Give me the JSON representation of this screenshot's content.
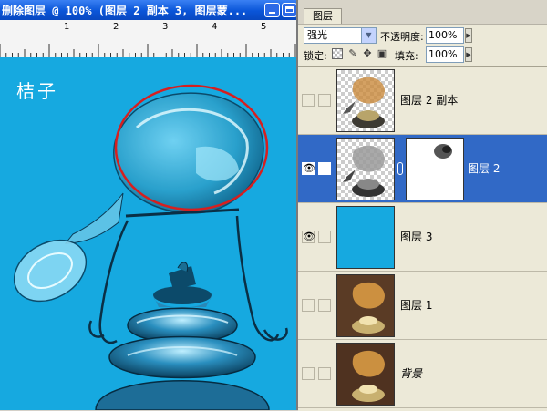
{
  "document": {
    "title": "删除图层 @ 100% (图层 2 副本 3, 图层蒙...",
    "canvas_text": "桔子",
    "ruler_numbers": [
      "1",
      "2",
      "3",
      "4",
      "5"
    ],
    "background_color": "#16a9e0"
  },
  "layers_panel": {
    "tab_label": "图层",
    "blend_mode": "强光",
    "opacity_label": "不透明度:",
    "opacity_value": "100%",
    "lock_label": "锁定:",
    "fill_label": "填充:",
    "fill_value": "100%",
    "selection_color": "#3169c6",
    "layers": [
      {
        "name": "图层 2 副本",
        "visible": false,
        "selected": false,
        "thumb": "glass-transparent"
      },
      {
        "name": "图层 2",
        "visible": true,
        "selected": true,
        "thumb": "glass-transparent",
        "has_mask": true
      },
      {
        "name": "图层 3",
        "visible": true,
        "selected": false,
        "thumb": "solid-blue"
      },
      {
        "name": "图层 1",
        "visible": false,
        "selected": false,
        "thumb": "photo"
      },
      {
        "name": "背景",
        "visible": false,
        "selected": false,
        "thumb": "photo",
        "italic": true
      }
    ]
  }
}
